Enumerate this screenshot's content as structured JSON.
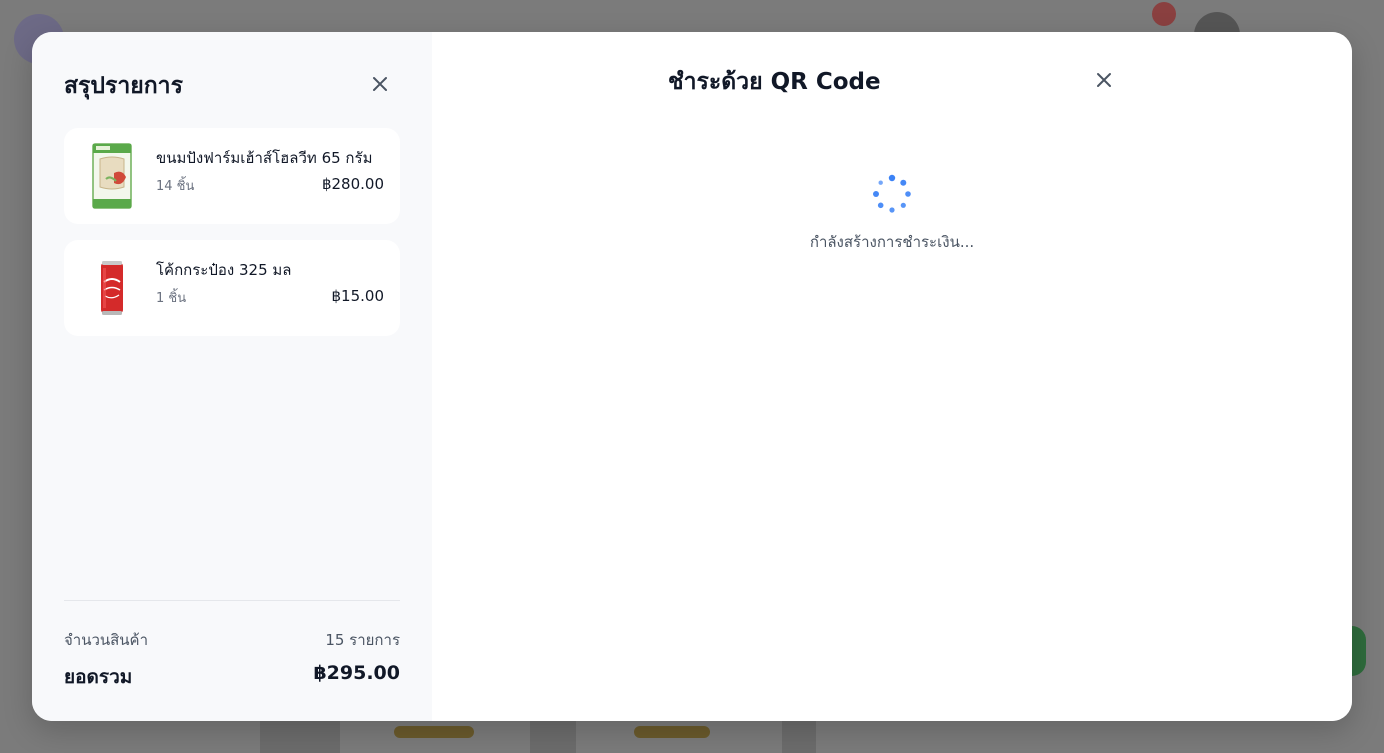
{
  "summary": {
    "title": "สรุปรายการ",
    "items": [
      {
        "name": "ขนมปังฟาร์มเฮ้าส์โฮลวีท 65 กรัม",
        "qty": "14 ชิ้น",
        "price": "฿280.00",
        "thumb_icon": "bread-package-icon"
      },
      {
        "name": "โค้กกระป๋อง 325 มล",
        "qty": "1 ชิ้น",
        "price": "฿15.00",
        "thumb_icon": "coke-can-icon"
      }
    ],
    "count_label": "จำนวนสินค้า",
    "count_value": "15 รายการ",
    "total_label": "ยอดรวม",
    "total_value": "฿295.00"
  },
  "qr": {
    "title": "ชำระด้วย QR Code",
    "loading_text": "กำลังสร้างการชำระเงิน..."
  },
  "colors": {
    "spinner": "#3b82f6",
    "text_primary": "#111827",
    "text_secondary": "#4b5563",
    "summary_bg": "#f8f9fb"
  }
}
